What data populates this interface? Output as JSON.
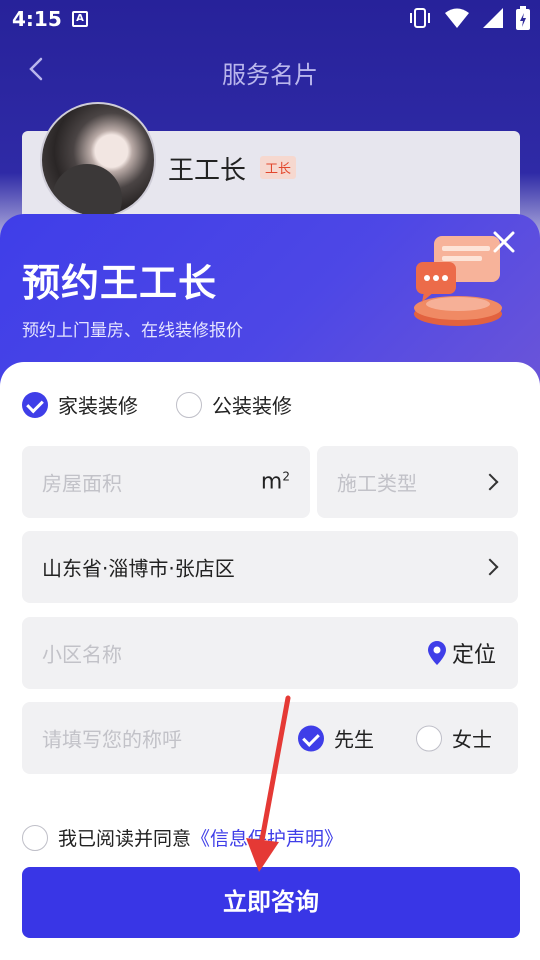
{
  "status_bar": {
    "time": "4:15",
    "notification_icon": "A"
  },
  "nav": {
    "title": "服务名片"
  },
  "worker": {
    "name": "王工长",
    "tag": "工长"
  },
  "sheet": {
    "title": "预约王工长",
    "subtitle": "预约上门量房、在线装修报价"
  },
  "decoration_type": {
    "options": [
      {
        "label": "家装装修",
        "selected": true
      },
      {
        "label": "公装装修",
        "selected": false
      }
    ]
  },
  "form": {
    "area_placeholder": "房屋面积",
    "area_unit": "m",
    "area_unit_sup": "2",
    "construction_type_placeholder": "施工类型",
    "location_value": "山东省·淄博市·张店区",
    "community_placeholder": "小区名称",
    "locate_label": "定位",
    "name_placeholder": "请填写您的称呼",
    "gender_options": [
      {
        "label": "先生",
        "selected": true
      },
      {
        "label": "女士",
        "selected": false
      }
    ]
  },
  "agreement": {
    "text": "我已阅读并同意",
    "link": "《信息保护声明》",
    "checked": false
  },
  "submit_label": "立即咨询",
  "colors": {
    "primary": "#3936e6",
    "accent_tag": "#e2472d",
    "annotation": "#e53935"
  }
}
